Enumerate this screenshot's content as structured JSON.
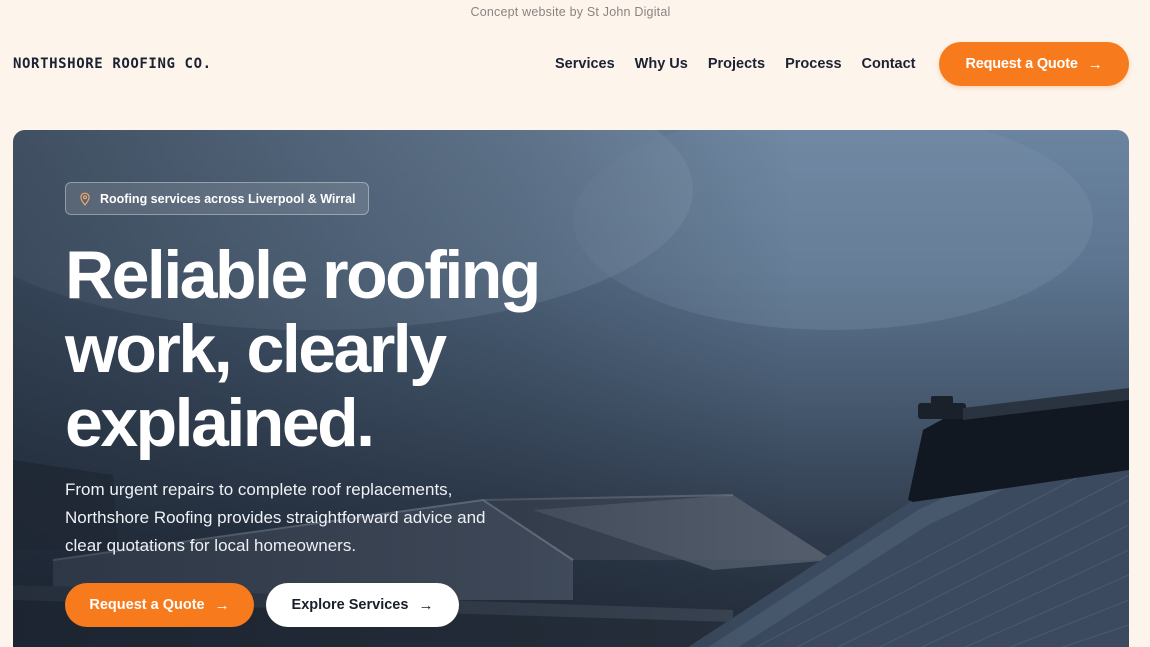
{
  "credit": "Concept website by St John Digital",
  "brand": "NORTHSHORE ROOFING CO.",
  "nav": {
    "items": [
      "Services",
      "Why Us",
      "Projects",
      "Process",
      "Contact"
    ],
    "cta_label": "Request a Quote"
  },
  "hero": {
    "badge": "Roofing services across Liverpool & Wirral",
    "headline_lines": [
      "Reliable roofing",
      "work, clearly",
      "explained."
    ],
    "lede": "From urgent repairs to complete roof replacements, Northshore Roofing provides straightforward advice and clear quotations for local homeowners.",
    "primary_cta": "Request a Quote",
    "secondary_cta": "Explore Services"
  },
  "icons": {
    "badge": "map-pin-icon",
    "cta_arrow": "arrow-right-icon"
  },
  "colors": {
    "accent": "#f77a1c",
    "background": "#fdf4ec",
    "ink": "#1c2230"
  }
}
